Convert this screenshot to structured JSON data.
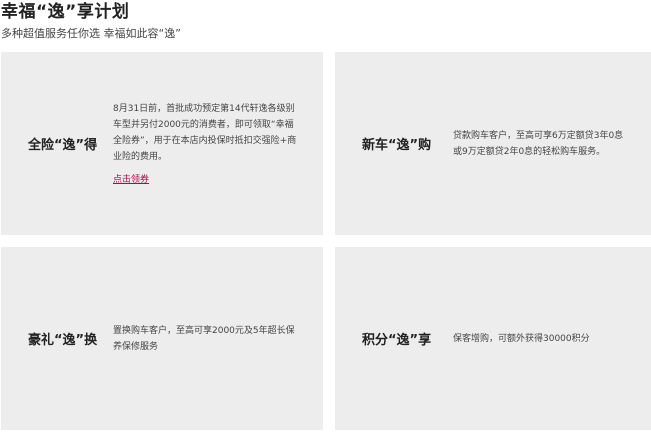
{
  "header": {
    "title": "幸福“逸”享计划",
    "subtitle": "多种超值服务任你选 幸福如此容“逸”"
  },
  "cards": [
    {
      "name": "全险“逸”得",
      "desc": "8月31日前，首批成功预定第14代轩逸各级别车型并另付2000元的消费者，即可领取“幸福全险券”，用于在本店内投保时抵扣交强险+商业险的费用。",
      "link": "点击领券"
    },
    {
      "name": "新车“逸”购",
      "desc": "贷款购车客户，至高可享6万定额贷3年0息或9万定额贷2年0息的轻松购车服务。"
    },
    {
      "name": "豪礼“逸”换",
      "desc": "置换购车客户，至高可享2000元及5年超长保养保修服务"
    },
    {
      "name": "积分“逸”享",
      "desc": "保客增购，可额外获得30000积分"
    }
  ],
  "colors": {
    "card_bg": "#ededed",
    "link": "#a3104a"
  }
}
